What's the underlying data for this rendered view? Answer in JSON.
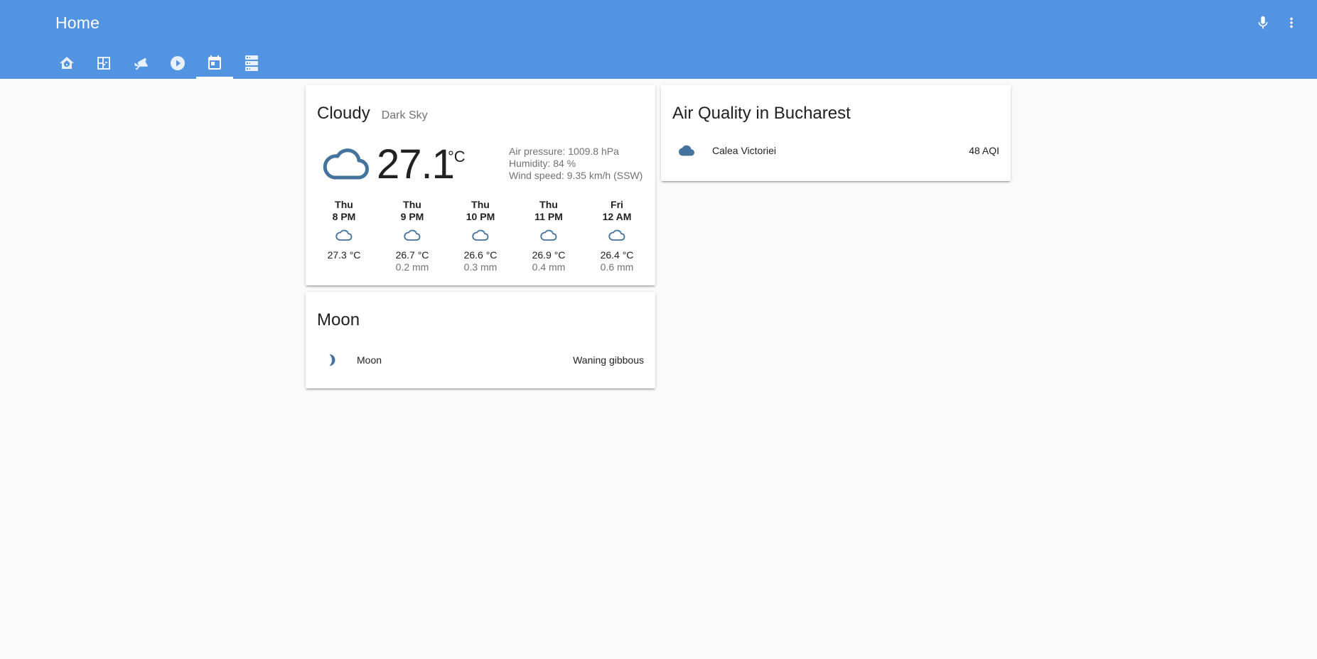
{
  "app": {
    "title": "Home",
    "accent": "#5294e2",
    "icon_color": "#44739e"
  },
  "toolbar": {
    "actions": [
      {
        "name": "microphone-icon"
      },
      {
        "name": "more-vert-icon"
      }
    ],
    "tabs": [
      {
        "name": "home-automation-icon",
        "active": false
      },
      {
        "name": "floor-plan-icon",
        "active": false
      },
      {
        "name": "cctv-icon",
        "active": false
      },
      {
        "name": "play-circle-icon",
        "active": false
      },
      {
        "name": "calendar-today-icon",
        "active": true
      },
      {
        "name": "server-icon",
        "active": false
      }
    ]
  },
  "weather": {
    "state": "Cloudy",
    "source": "Dark Sky",
    "temperature": "27.1",
    "unit": "°C",
    "icon": "cloudy-icon",
    "attributes": {
      "pressure": "Air pressure: 1009.8 hPa",
      "humidity": "Humidity: 84 %",
      "wind": "Wind speed: 9.35 km/h (SSW)"
    },
    "forecast": [
      {
        "day": "Thu",
        "time": "8 PM",
        "temp": "27.3 °C",
        "precip": ""
      },
      {
        "day": "Thu",
        "time": "9 PM",
        "temp": "26.7 °C",
        "precip": "0.2 mm"
      },
      {
        "day": "Thu",
        "time": "10 PM",
        "temp": "26.6 °C",
        "precip": "0.3 mm"
      },
      {
        "day": "Thu",
        "time": "11 PM",
        "temp": "26.9 °C",
        "precip": "0.4 mm"
      },
      {
        "day": "Fri",
        "time": "12 AM",
        "temp": "26.4 °C",
        "precip": "0.6 mm"
      }
    ]
  },
  "moon": {
    "title": "Moon",
    "entity": {
      "name": "Moon",
      "state": "Waning gibbous",
      "icon": "moon-waning-gibbous-icon"
    }
  },
  "air_quality": {
    "title": "Air Quality in Bucharest",
    "entity": {
      "name": "Calea Victoriei",
      "state": "48 AQI",
      "icon": "cloud-icon"
    }
  }
}
